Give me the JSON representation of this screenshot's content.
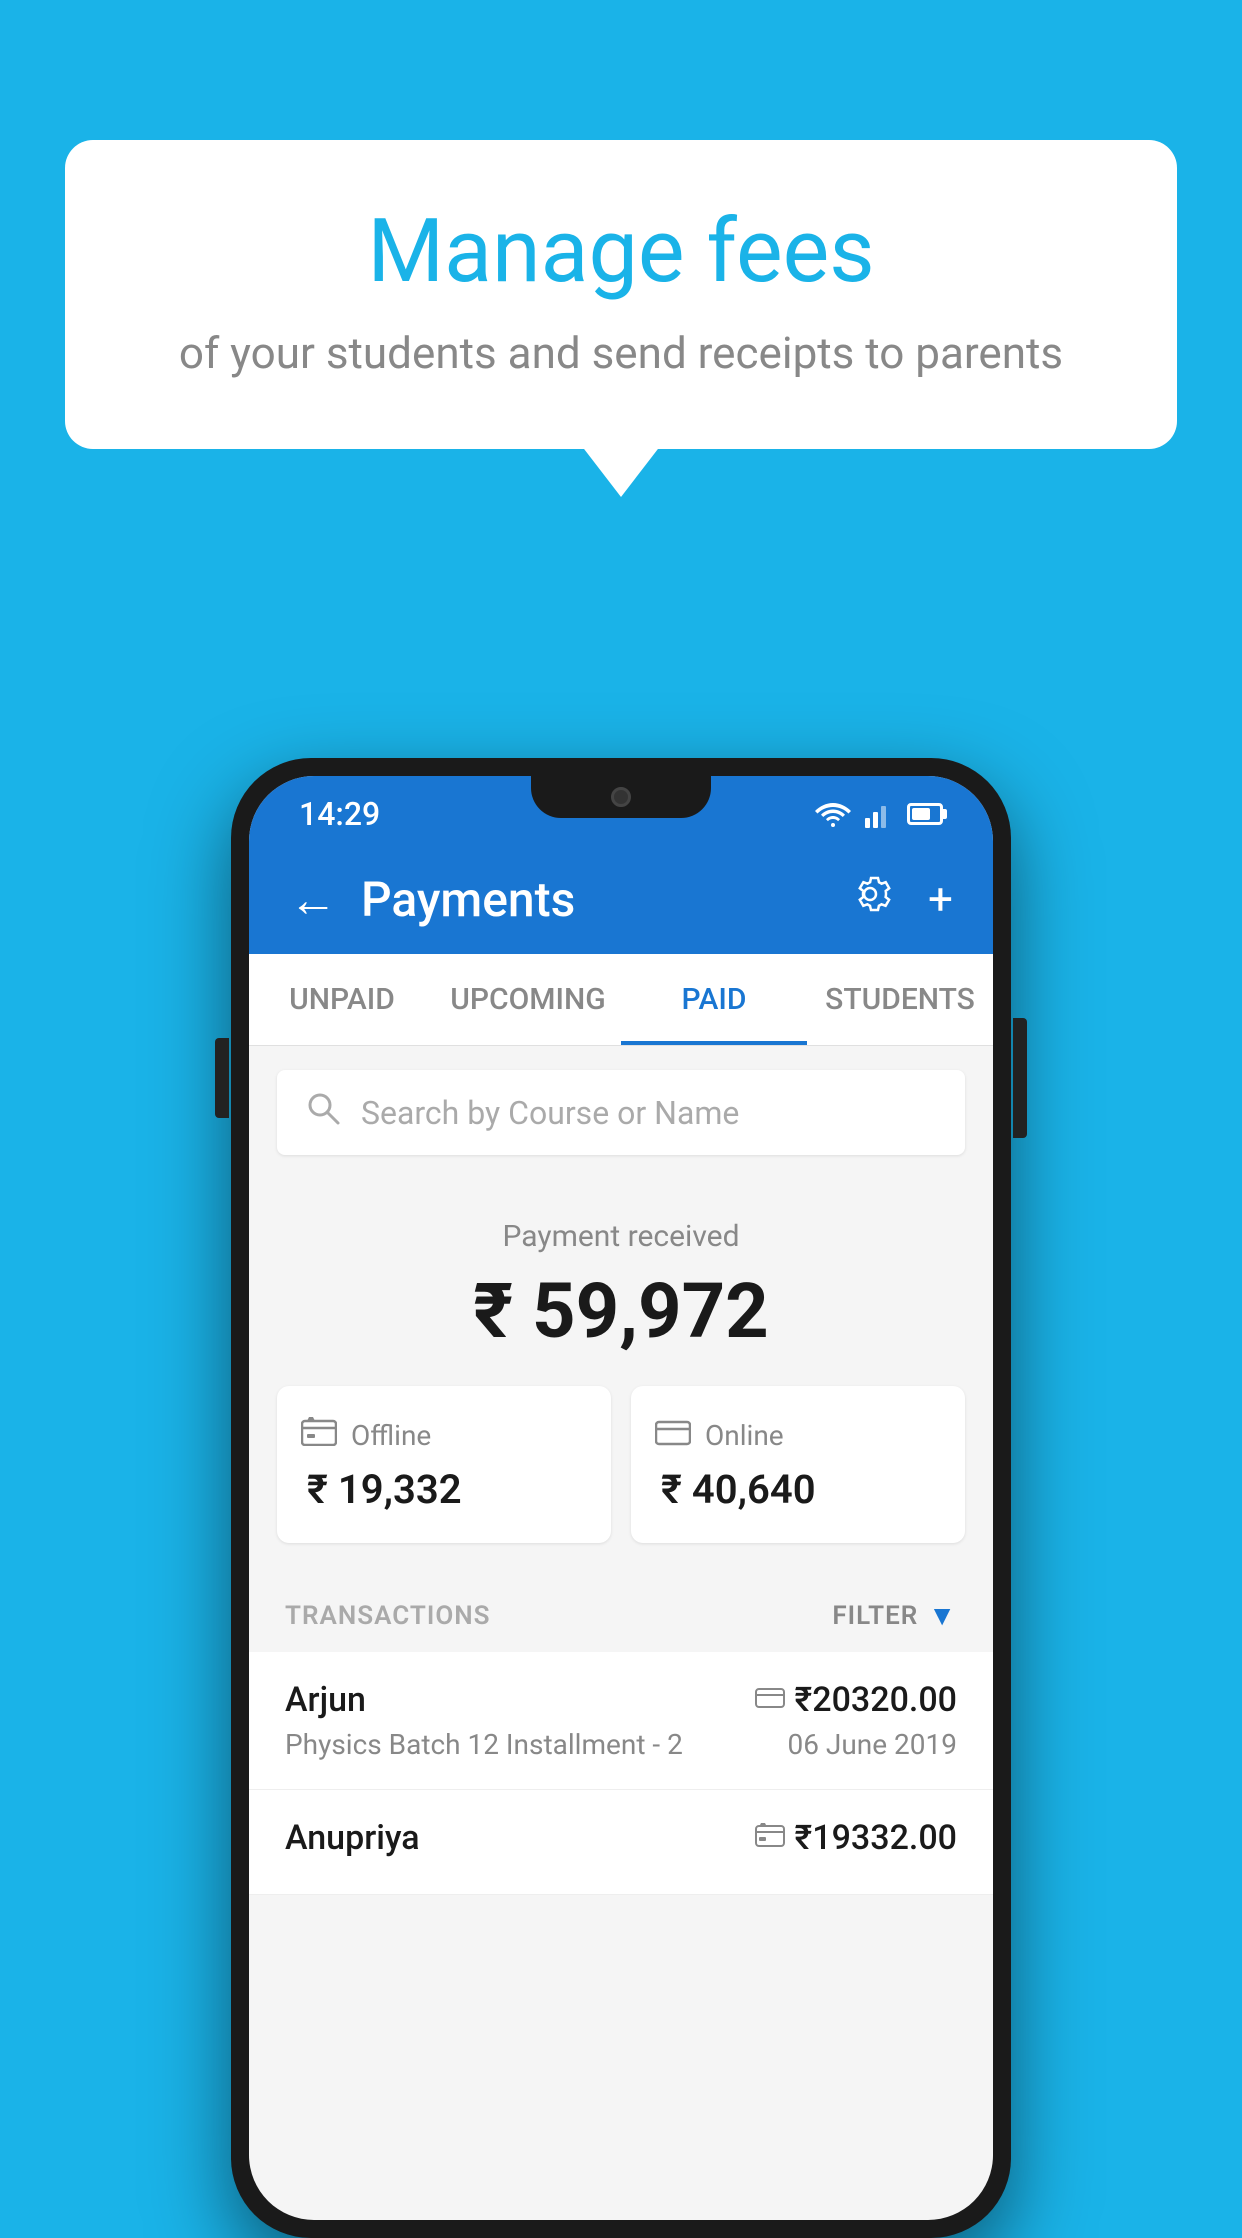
{
  "background_color": "#1ab3e8",
  "bubble": {
    "title": "Manage fees",
    "subtitle": "of your students and send receipts to parents"
  },
  "status_bar": {
    "time": "14:29"
  },
  "header": {
    "title": "Payments",
    "back_label": "←",
    "gear_label": "⚙",
    "plus_label": "+"
  },
  "tabs": [
    {
      "label": "UNPAID",
      "active": false
    },
    {
      "label": "UPCOMING",
      "active": false
    },
    {
      "label": "PAID",
      "active": true
    },
    {
      "label": "STUDENTS",
      "active": false
    }
  ],
  "search": {
    "placeholder": "Search by Course or Name"
  },
  "payment": {
    "label": "Payment received",
    "total": "₹ 59,972",
    "offline": {
      "label": "Offline",
      "amount": "₹ 19,332"
    },
    "online": {
      "label": "Online",
      "amount": "₹ 40,640"
    }
  },
  "transactions": {
    "header_label": "TRANSACTIONS",
    "filter_label": "FILTER",
    "rows": [
      {
        "name": "Arjun",
        "course": "Physics Batch 12 Installment - 2",
        "amount": "₹20320.00",
        "date": "06 June 2019",
        "payment_type": "online"
      },
      {
        "name": "Anupriya",
        "course": "",
        "amount": "₹19332.00",
        "date": "",
        "payment_type": "offline"
      }
    ]
  }
}
